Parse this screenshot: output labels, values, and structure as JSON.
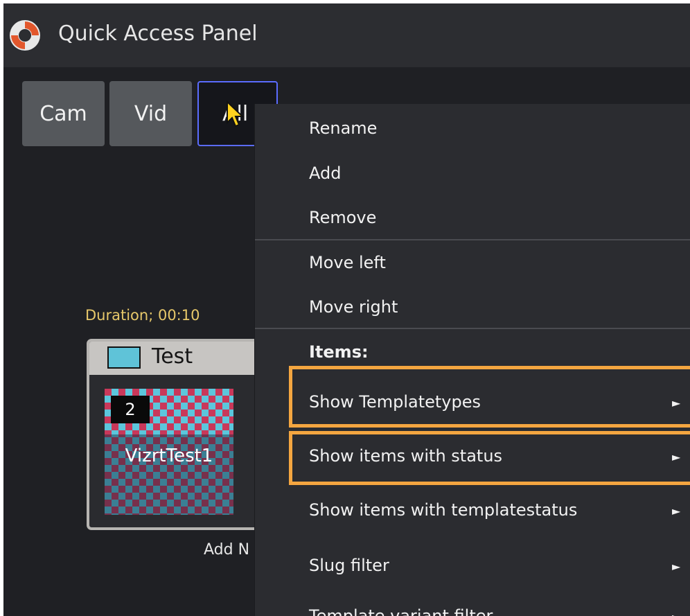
{
  "window": {
    "title": "Quick Access Panel",
    "logo_icon": "app-logo-icon"
  },
  "tabs": [
    {
      "label": "Cam"
    },
    {
      "label": "Vid"
    },
    {
      "label": "All"
    }
  ],
  "card": {
    "duration": "Duration; 00:10",
    "name": "Test",
    "swatch_color": "#5fc3d8",
    "badge": "2",
    "thumbnail_label": "VizrtTest1"
  },
  "add_label": "Add N",
  "context_menu": {
    "items": [
      {
        "label": "Rename"
      },
      {
        "label": "Add"
      },
      {
        "label": "Remove"
      },
      {
        "label": "Move left"
      },
      {
        "label": "Move right"
      },
      {
        "label": "Items:"
      },
      {
        "label": "Show Templatetypes"
      },
      {
        "label": "Show items with status"
      },
      {
        "label": "Show items with templatestatus"
      },
      {
        "label": "Slug filter"
      },
      {
        "label": "Template variant filter"
      }
    ],
    "submenu_arrow": "►",
    "highlight_color": "#f4a640"
  }
}
